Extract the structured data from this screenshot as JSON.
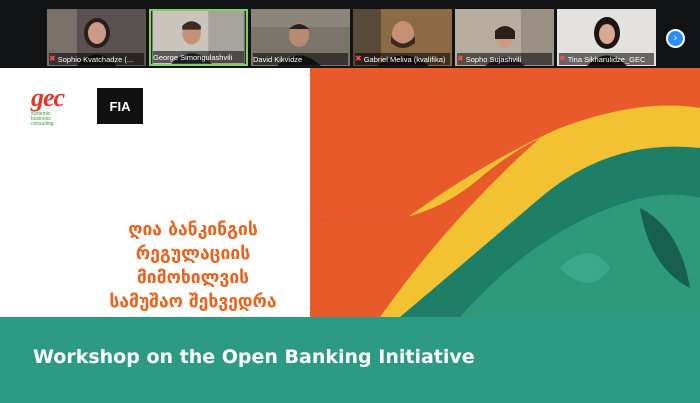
{
  "participants": [
    {
      "name": "Sophio Kvatchadze (...",
      "muted": true,
      "active": false
    },
    {
      "name": "George Simongulashvili",
      "muted": false,
      "active": true
    },
    {
      "name": "David Kikvidze",
      "muted": false,
      "active": false
    },
    {
      "name": "Gabriel Meliva (kvalifika)",
      "muted": true,
      "active": false
    },
    {
      "name": "Sopho Sujashvili",
      "muted": true,
      "active": false
    },
    {
      "name": "Tina Sikharulidze_GEC",
      "muted": true,
      "active": false
    }
  ],
  "strip": {
    "next_icon": "›"
  },
  "slide": {
    "gec_logo_text": "gec",
    "gec_tagline": "systemic business consulting",
    "fia_logo_text": "FIA",
    "georgian_title_lines": [
      "ღია ბანკინგის",
      "რეგულაციის",
      "მიმოხილვის",
      "სამუშაო შეხვედრა"
    ]
  },
  "caption": {
    "text": "Workshop on the Open Banking Initiative"
  },
  "colors": {
    "caption_bg": "#2d9a83",
    "title_orange": "#e8631f",
    "active_border": "#7fd15a",
    "next_button": "#2d8cff"
  }
}
